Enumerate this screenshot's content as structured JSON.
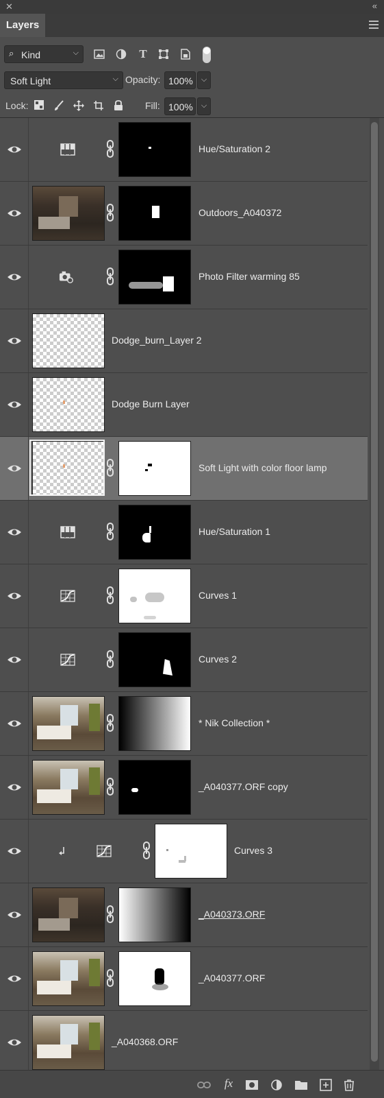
{
  "panel": {
    "title": "Layers"
  },
  "filter": {
    "kind_label": "Kind"
  },
  "blend": {
    "mode": "Soft Light",
    "opacity_label": "Opacity:",
    "opacity_value": "100%"
  },
  "lock": {
    "label": "Lock:",
    "fill_label": "Fill:",
    "fill_value": "100%"
  },
  "layers": [
    {
      "name": "Hue/Saturation 2",
      "kind": "adjustment-hue-saturation",
      "mask": "black-with-small-dot",
      "visible": true
    },
    {
      "name": "Outdoors_A040372",
      "kind": "photo",
      "mask": "black-with-window",
      "visible": true
    },
    {
      "name": "Photo Filter warming 85",
      "kind": "adjustment-photo-filter",
      "mask": "black-with-highlights",
      "visible": true
    },
    {
      "name": "Dodge_burn_Layer 2",
      "kind": "transparent-pixel-layer",
      "visible": true
    },
    {
      "name": "Dodge Burn Layer",
      "kind": "transparent-pixel-layer",
      "visible": true
    },
    {
      "name": "Soft Light with color floor lamp",
      "kind": "transparent-pixel-layer",
      "mask": "white-with-dots",
      "visible": true,
      "selected": true
    },
    {
      "name": "Hue/Saturation 1",
      "kind": "adjustment-hue-saturation",
      "mask": "black-with-lamp",
      "visible": true
    },
    {
      "name": "Curves 1",
      "kind": "adjustment-curves",
      "mask": "white-with-smudges",
      "visible": true
    },
    {
      "name": "Curves 2",
      "kind": "adjustment-curves",
      "mask": "black-with-shape",
      "visible": true
    },
    {
      "name": "* Nik Collection *",
      "kind": "photo",
      "mask": "gradient-black-to-white",
      "visible": true
    },
    {
      "name": "_A040377.ORF copy",
      "kind": "photo",
      "mask": "black-with-spot",
      "visible": true
    },
    {
      "name": "Curves 3",
      "kind": "adjustment-curves-clipped",
      "mask": "white-faint",
      "visible": true
    },
    {
      "name": "_A040373.ORF",
      "kind": "photo",
      "mask": "gradient-white-to-black",
      "visible": true,
      "underlined": true
    },
    {
      "name": "_A040377.ORF",
      "kind": "photo",
      "mask": "white-with-black-blob",
      "visible": true
    },
    {
      "name": "_A040368.ORF",
      "kind": "photo",
      "visible": true
    }
  ],
  "bottom_icons": [
    "link-icon",
    "fx-icon",
    "mask-icon",
    "adjustment-icon",
    "folder-icon",
    "new-layer-icon",
    "trash-icon"
  ],
  "colors": {
    "panel_bg": "#4e4e4e",
    "selected_row": "#707070",
    "dark_field": "#363636"
  }
}
